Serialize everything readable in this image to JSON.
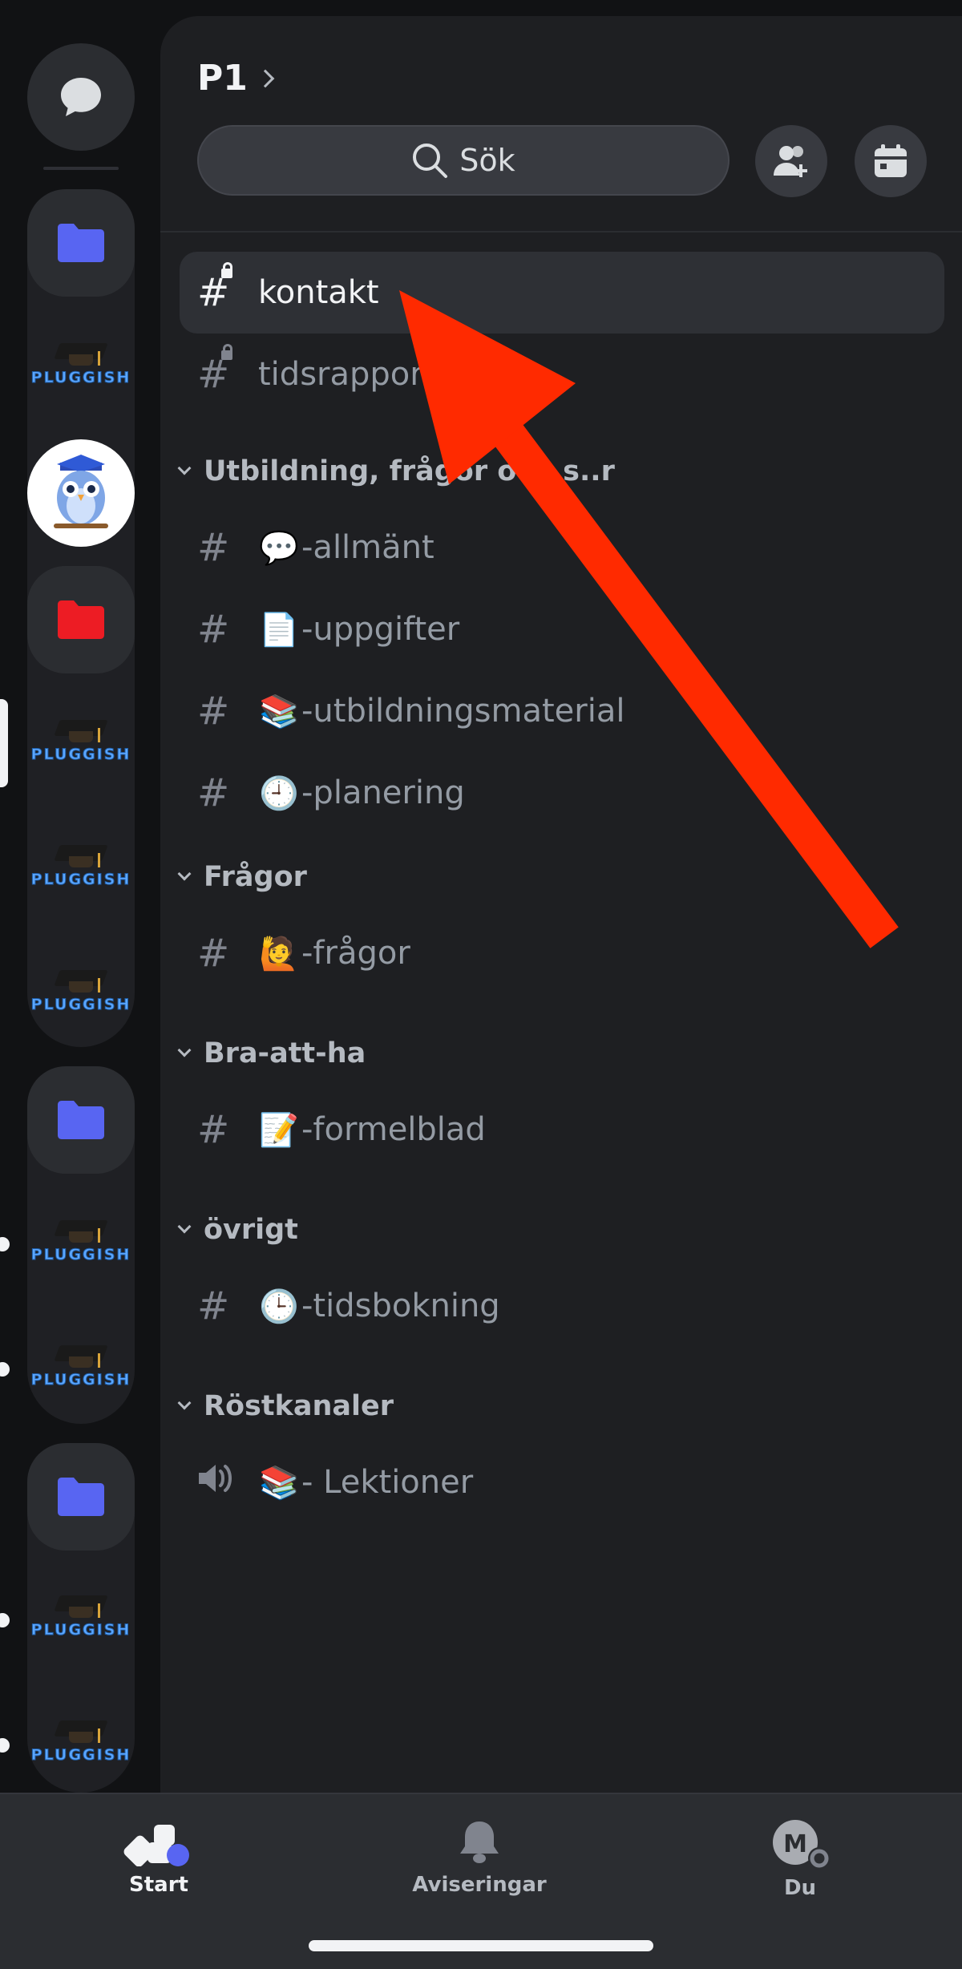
{
  "server": {
    "name": "P1"
  },
  "search": {
    "label": "Sök"
  },
  "channels_top": [
    {
      "name": "kontakt",
      "locked": true,
      "selected": true
    },
    {
      "name": "tidsrappor",
      "locked": true,
      "selected": false
    }
  ],
  "categories": [
    {
      "label": "Utbildning, frågor och s..r",
      "channels": [
        {
          "emoji": "💬",
          "name": "-allmänt"
        },
        {
          "emoji": "📄",
          "name": "-uppgifter"
        },
        {
          "emoji": "📚",
          "name": "-utbildningsmaterial"
        },
        {
          "emoji": "🕘",
          "name": "-planering"
        }
      ]
    },
    {
      "label": "Frågor",
      "channels": [
        {
          "emoji": "🙋",
          "name": "-frågor"
        }
      ]
    },
    {
      "label": "Bra-att-ha",
      "channels": [
        {
          "emoji": "📝",
          "name": "-formelblad"
        }
      ]
    },
    {
      "label": "övrigt",
      "channels": [
        {
          "emoji": "🕒",
          "name": "-tidsbokning"
        }
      ]
    },
    {
      "label": "Röstkanaler",
      "channels": [
        {
          "emoji": "📚",
          "name": "- Lektioner",
          "voice": true
        }
      ]
    }
  ],
  "rail": {
    "pluggish_text": "PLUGGISH"
  },
  "nav": {
    "start": "Start",
    "notifications": "Aviseringar",
    "you": "Du",
    "avatar_letter": "M"
  },
  "colors": {
    "accent": "#5865f2",
    "folder_blue": "#5865f2",
    "folder_red": "#ed1c24",
    "annotation_arrow": "#ff2a00"
  }
}
